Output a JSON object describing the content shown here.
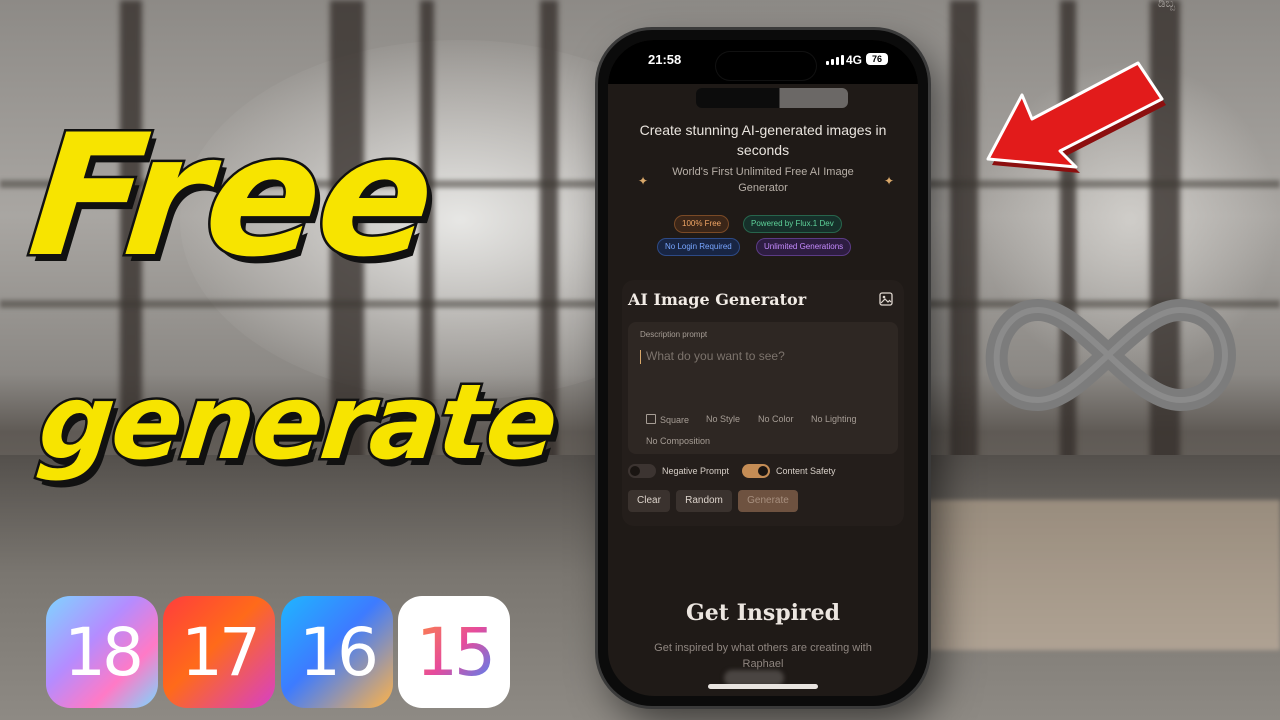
{
  "overlay": {
    "hero_line1": "Free",
    "hero_line2": "generate",
    "ios_versions": [
      "18",
      "17",
      "16",
      "15"
    ],
    "corner_mark": "ಡಿಬ್ಬ",
    "colors": {
      "hero_yellow": "#f7e400",
      "arrow_red": "#e21b1b",
      "infinity_gray": "#7c7c7c"
    },
    "icons": [
      "red-arrow-icon",
      "infinity-icon"
    ]
  },
  "phone": {
    "status_bar": {
      "time": "21:58",
      "network": "4G",
      "battery": "76"
    },
    "hero": {
      "headline": "Create stunning AI-generated images in seconds",
      "subline": "World's First Unlimited Free AI Image Generator",
      "badges": [
        {
          "label": "100% Free",
          "color": "#f2a766"
        },
        {
          "label": "Powered by Flux.1 Dev",
          "color": "#5ed39a"
        },
        {
          "label": "No Login Required",
          "color": "#78a6ff"
        },
        {
          "label": "Unlimited Generations",
          "color": "#c58bff"
        }
      ]
    },
    "generator": {
      "title": "AI Image Generator",
      "prompt_label": "Description prompt",
      "prompt_placeholder": "What do you want to see?",
      "options": [
        "Square",
        "No Style",
        "No Color",
        "No Lighting",
        "No Composition"
      ],
      "square_checked": false,
      "toggles": [
        {
          "label": "Negative Prompt",
          "on": false
        },
        {
          "label": "Content Safety",
          "on": true
        }
      ],
      "buttons": {
        "clear": "Clear",
        "random": "Random",
        "generate": "Generate"
      }
    },
    "inspired": {
      "title": "Get Inspired",
      "subtitle": "Get inspired by what others are creating with Raphael"
    }
  }
}
